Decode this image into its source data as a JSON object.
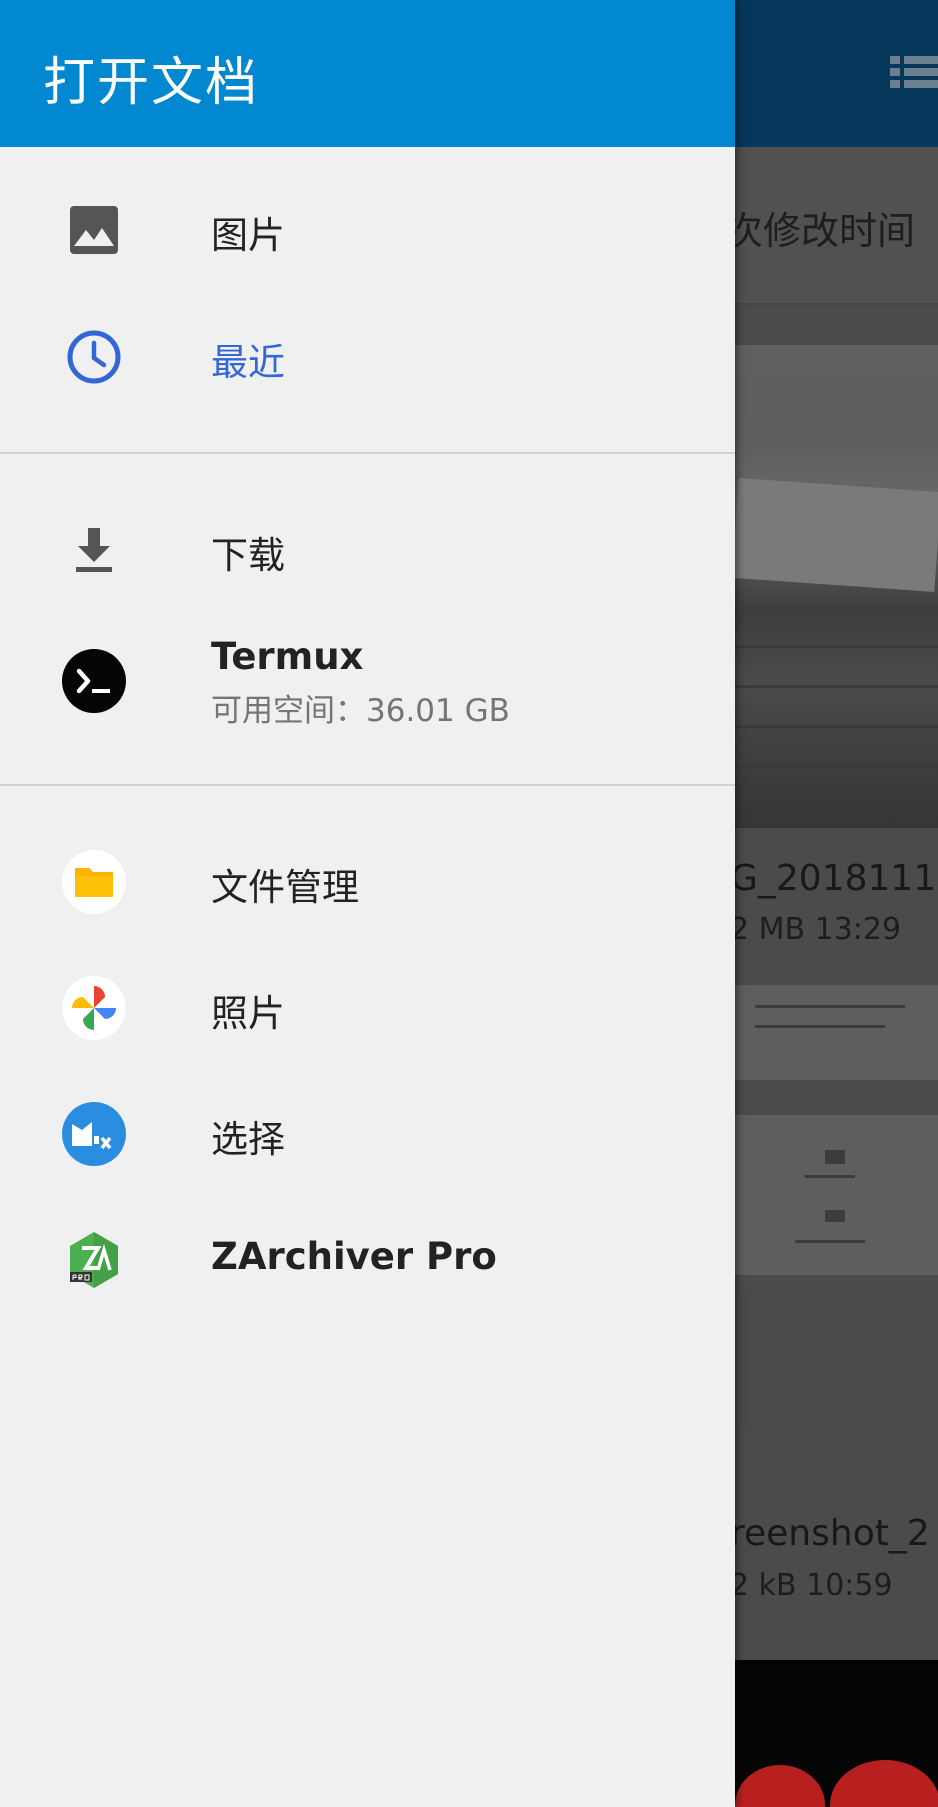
{
  "drawer": {
    "title": "打开文档",
    "sections": [
      {
        "items": [
          {
            "label": "图片",
            "icon": "image-icon"
          },
          {
            "label": "最近",
            "icon": "clock-icon",
            "active": true
          }
        ]
      },
      {
        "items": [
          {
            "label": "下载",
            "icon": "download-icon"
          },
          {
            "label": "Termux",
            "subtitle": "可用空间：36.01 GB",
            "icon": "termux-icon"
          }
        ]
      },
      {
        "items": [
          {
            "label": "文件管理",
            "icon": "file-manager-icon"
          },
          {
            "label": "照片",
            "icon": "photos-icon"
          },
          {
            "label": "选择",
            "icon": "select-app-icon"
          },
          {
            "label": "ZArchiver Pro",
            "icon": "zarchiver-icon"
          }
        ]
      }
    ]
  },
  "background": {
    "sort_label": "次修改时间",
    "files": [
      {
        "name": "G_2018111",
        "meta": "2 MB  13:29"
      },
      {
        "name": "reenshot_2",
        "meta": "2 kB  10:59"
      }
    ]
  },
  "colors": {
    "header": "#0288d1",
    "active": "#3367d6",
    "drawer_bg": "#f0f0f1"
  }
}
